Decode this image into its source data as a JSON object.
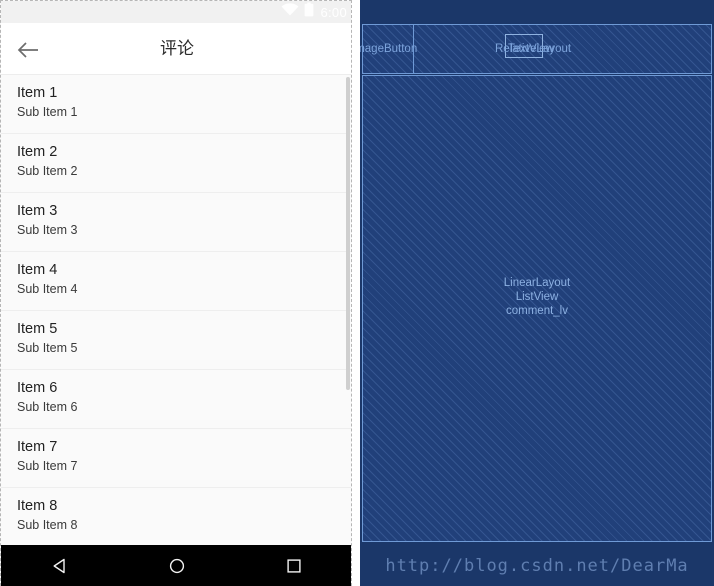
{
  "device": {
    "status_bar": {
      "time": "6:00",
      "icons": [
        "wifi-icon",
        "battery-icon"
      ]
    },
    "toolbar": {
      "back_icon": "back-arrow-icon",
      "title": "评论"
    },
    "list": {
      "items": [
        {
          "title": "Item 1",
          "sub": "Sub Item 1"
        },
        {
          "title": "Item 2",
          "sub": "Sub Item 2"
        },
        {
          "title": "Item 3",
          "sub": "Sub Item 3"
        },
        {
          "title": "Item 4",
          "sub": "Sub Item 4"
        },
        {
          "title": "Item 5",
          "sub": "Sub Item 5"
        },
        {
          "title": "Item 6",
          "sub": "Sub Item 6"
        },
        {
          "title": "Item 7",
          "sub": "Sub Item 7"
        },
        {
          "title": "Item 8",
          "sub": "Sub Item 8"
        }
      ]
    },
    "nav_bar": {
      "back": "nav-back-triangle-icon",
      "home": "nav-home-circle-icon",
      "recents": "nav-recents-square-icon"
    }
  },
  "blueprint": {
    "labels": {
      "image_button": "ImageButton",
      "relative_layout": "RelativeLayout",
      "text_view": "TextView",
      "linear_layout": "LinearLayout",
      "list_view": "ListView",
      "list_view_id": "comment_lv"
    },
    "watermark": "http://blog.csdn.net/DearMa",
    "colors": {
      "background": "#1b3769",
      "hatch_fill": "#21407a",
      "outline": "#6f9ad6",
      "label_text": "#7ca3db",
      "watermark_text": "#5f7eb0"
    }
  }
}
